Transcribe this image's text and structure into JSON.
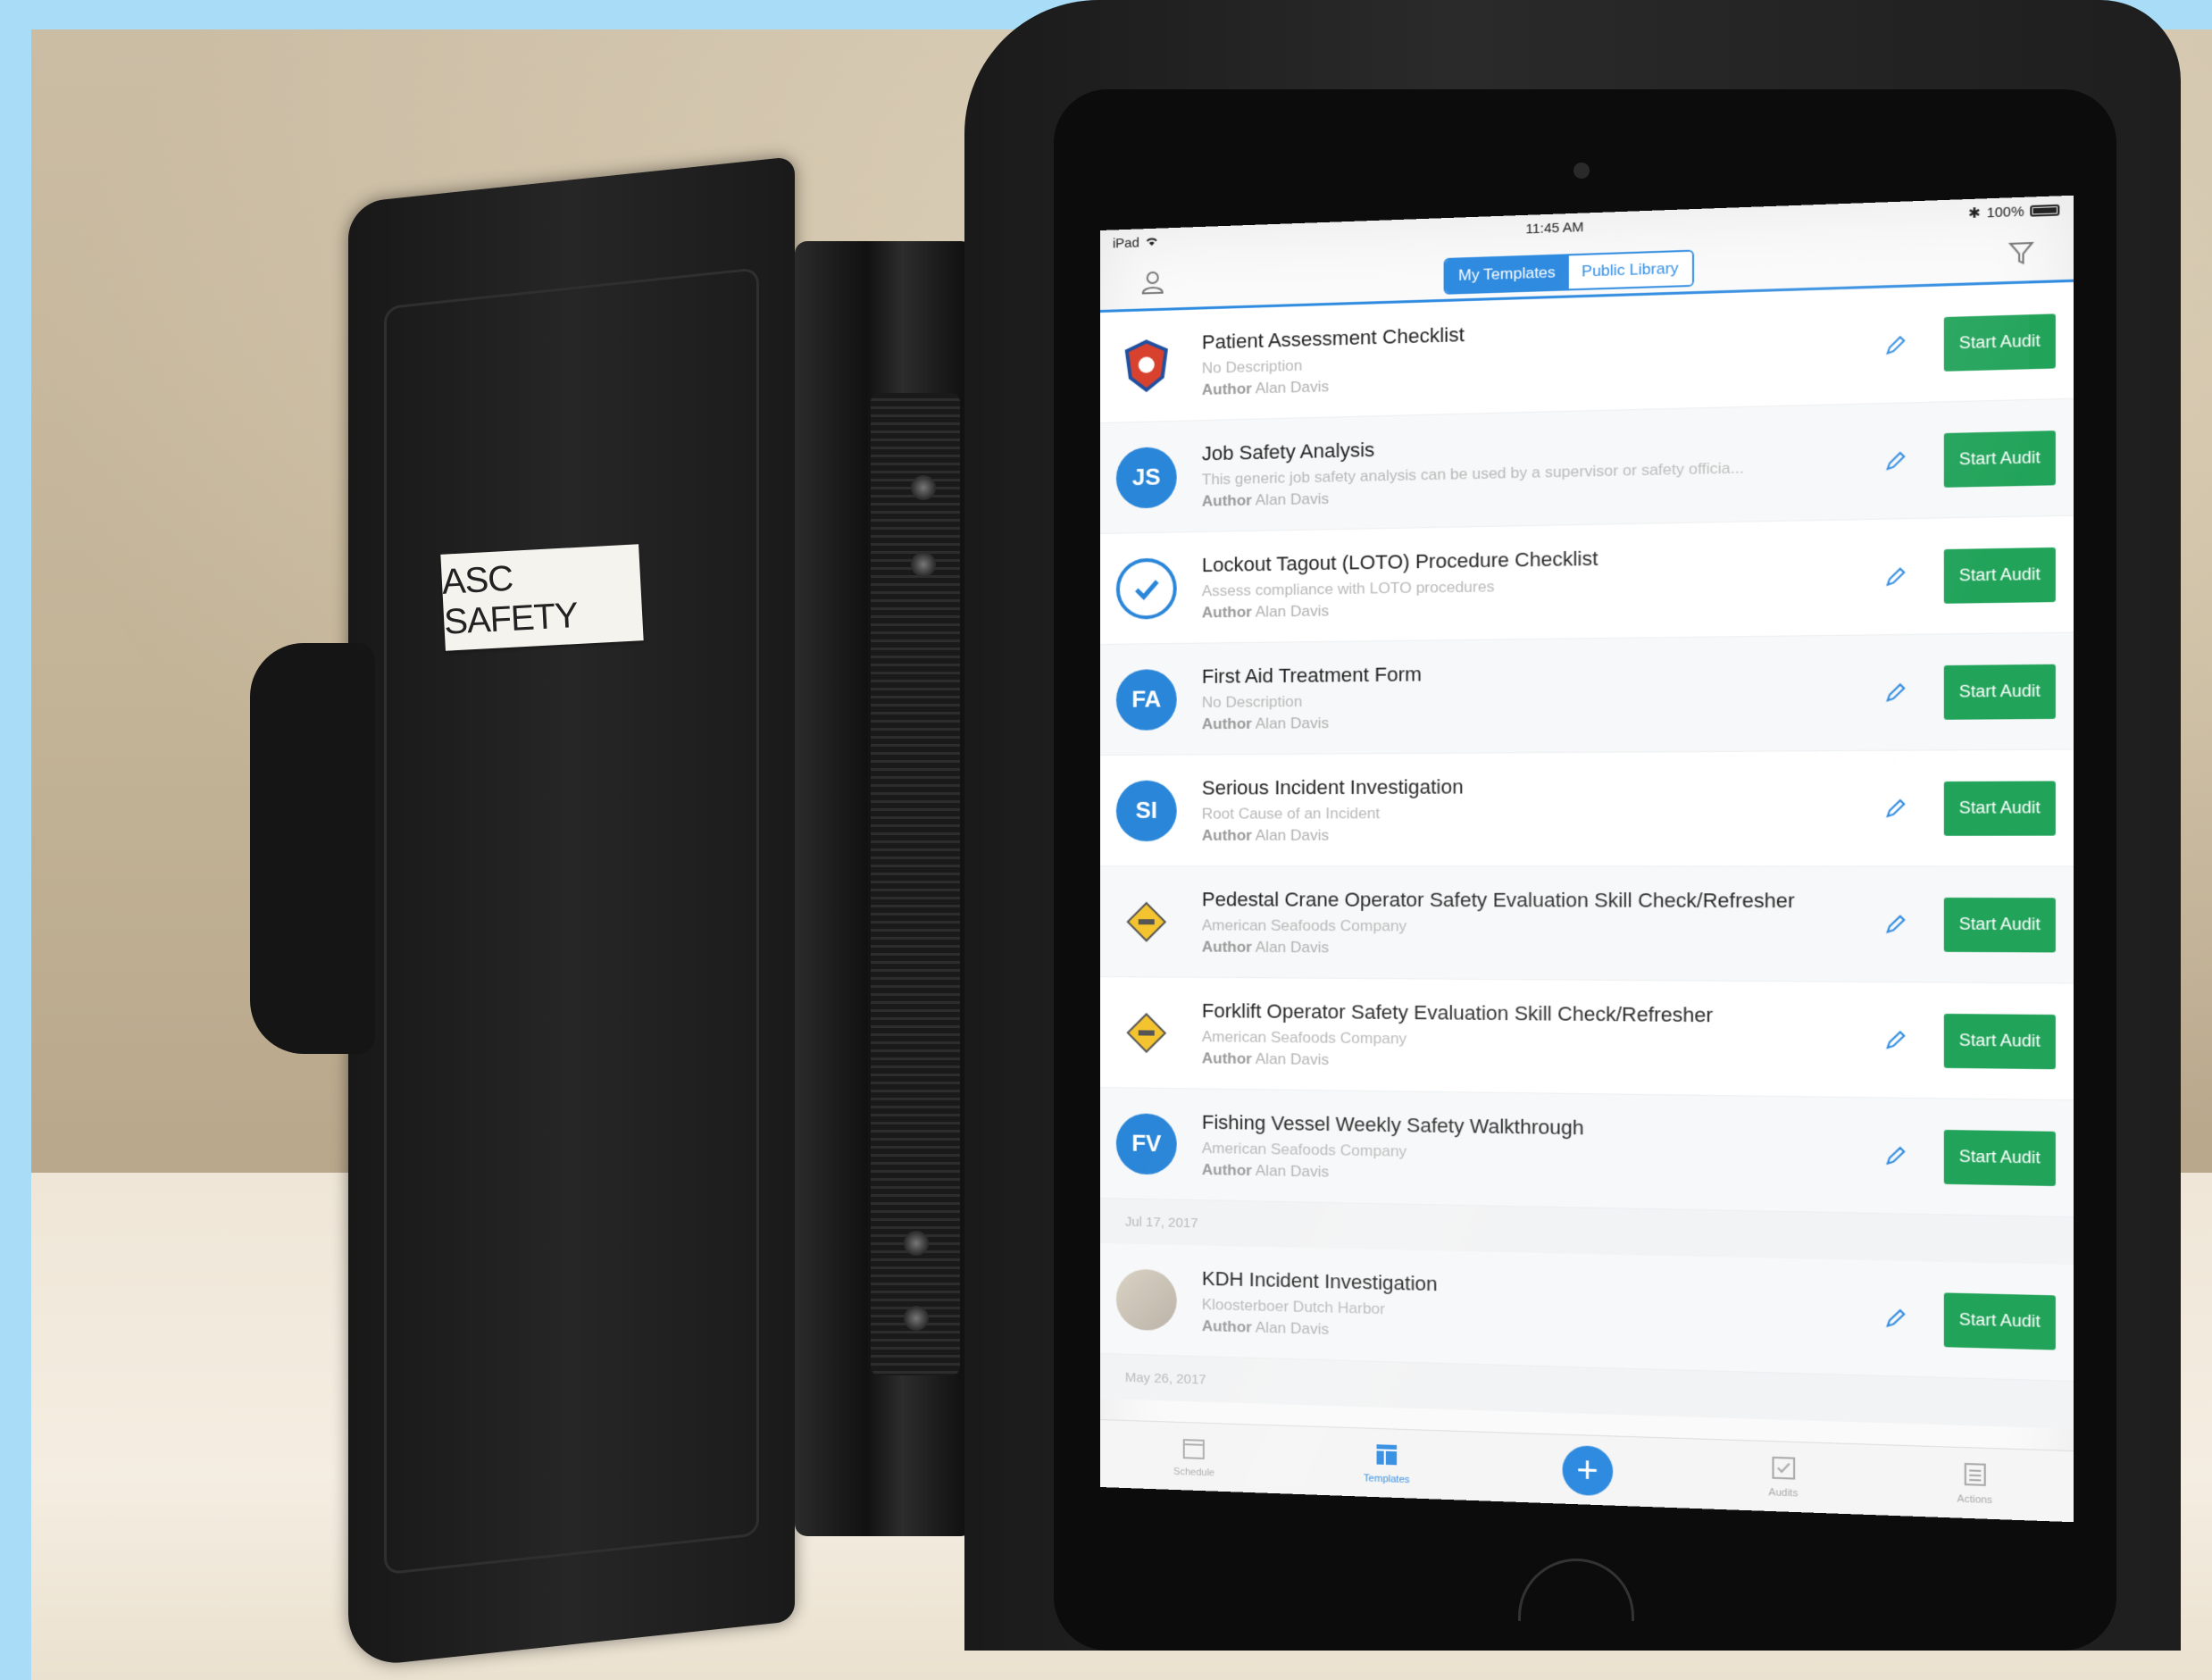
{
  "folder": {
    "label": "ASC SAFETY"
  },
  "status_bar": {
    "device": "iPad",
    "time": "11:45 AM",
    "battery": "100%"
  },
  "nav": {
    "segments": [
      {
        "label": "My Templates",
        "active": true
      },
      {
        "label": "Public Library",
        "active": false
      }
    ]
  },
  "templates": [
    {
      "title": "Patient Assessment Checklist",
      "description": "No Description",
      "author_label": "Author",
      "author": "Alan Davis",
      "avatar_type": "crest",
      "initials": "",
      "action": "Start Audit"
    },
    {
      "title": "Job Safety Analysis",
      "description": "This generic job safety analysis can be used by a supervisor or safety officia...",
      "author_label": "Author",
      "author": "Alan Davis",
      "avatar_type": "blue",
      "initials": "JS",
      "action": "Start Audit"
    },
    {
      "title": "Lockout Tagout (LOTO) Procedure Checklist",
      "description": "Assess compliance with LOTO procedures",
      "author_label": "Author",
      "author": "Alan Davis",
      "avatar_type": "check",
      "initials": "",
      "action": "Start Audit"
    },
    {
      "title": "First Aid Treatment Form",
      "description": "No Description",
      "author_label": "Author",
      "author": "Alan Davis",
      "avatar_type": "blue",
      "initials": "FA",
      "action": "Start Audit"
    },
    {
      "title": "Serious Incident Investigation",
      "description": "Root Cause of an Incident",
      "author_label": "Author",
      "author": "Alan Davis",
      "avatar_type": "blue",
      "initials": "SI",
      "action": "Start Audit"
    },
    {
      "title": "Pedestal Crane Operator Safety Evaluation Skill Check/Refresher",
      "description": "American Seafoods Company",
      "author_label": "Author",
      "author": "Alan Davis",
      "avatar_type": "diamond",
      "initials": "",
      "action": "Start Audit"
    },
    {
      "title": "Forklift Operator Safety Evaluation Skill Check/Refresher",
      "description": "American Seafoods Company",
      "author_label": "Author",
      "author": "Alan Davis",
      "avatar_type": "diamond",
      "initials": "",
      "action": "Start Audit"
    },
    {
      "title": "Fishing Vessel Weekly Safety Walkthrough",
      "description": "American Seafoods Company",
      "author_label": "Author",
      "author": "Alan Davis",
      "avatar_type": "blue",
      "initials": "FV",
      "action": "Start Audit"
    }
  ],
  "section_date": "Jul 17, 2017",
  "section_templates": [
    {
      "title": "KDH Incident Investigation",
      "description": "Kloosterboer Dutch Harbor",
      "author_label": "Author",
      "author": "Alan Davis",
      "avatar_type": "photo",
      "initials": "",
      "action": "Start Audit"
    }
  ],
  "section_date_2": "May 26, 2017",
  "tab_bar": {
    "tabs": [
      {
        "label": "Schedule",
        "icon": "calendar-icon",
        "active": false
      },
      {
        "label": "Templates",
        "icon": "templates-icon",
        "active": true
      },
      {
        "label": "",
        "icon": "plus-icon",
        "active": false
      },
      {
        "label": "Audits",
        "icon": "audits-icon",
        "active": false
      },
      {
        "label": "Actions",
        "icon": "actions-icon",
        "active": false
      }
    ]
  },
  "colors": {
    "accent": "#2f8be0",
    "start_button": "#21a35a",
    "background": "#a9dcf7"
  }
}
